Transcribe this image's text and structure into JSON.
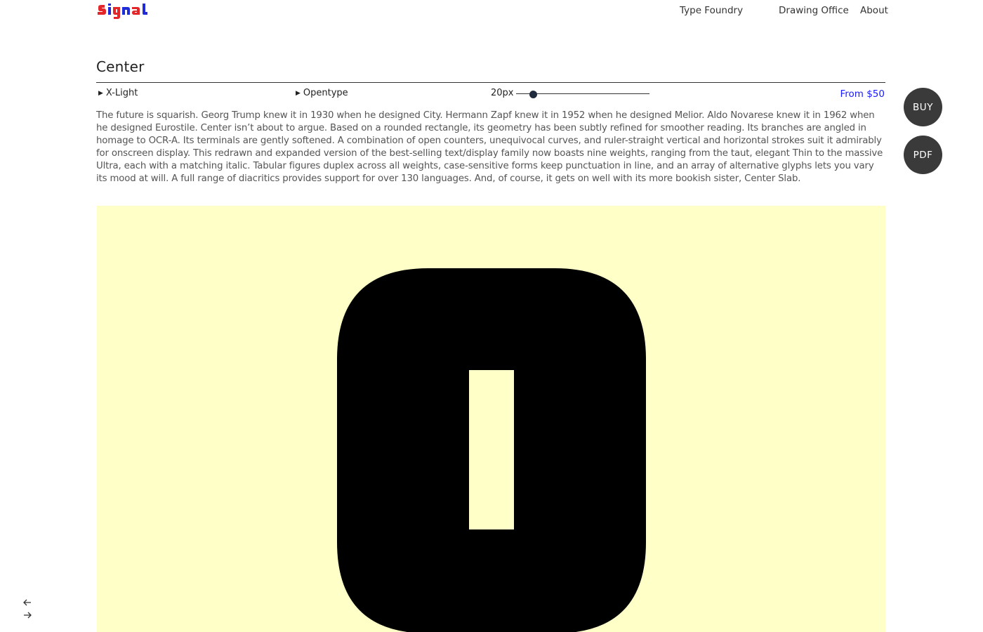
{
  "header": {
    "logo_text": "Signal",
    "nav": [
      {
        "label": "Type Foundry"
      },
      {
        "label": "Drawing Office"
      },
      {
        "label": "About"
      }
    ]
  },
  "font": {
    "name": "Center",
    "weight_selector": "X-Light",
    "features_selector": "Opentype",
    "size_label": "20px",
    "size_slider_fraction": 0.1,
    "price_label": "From $50",
    "description": "The future is squarish. Georg Trump knew it in 1930 when he designed City. Hermann Zapf knew it in 1952 when he designed Melior. Aldo Novarese knew it in 1962 when he designed Eurostile. Center isn’t about to argue. Based on a rounded rectangle, its geometry has been subtly refined for smoother reading. Its branches are angled in homage to OCR-A. Its terminals are gently softened. A combination of open counters, unequivocal curves, and ruler-straight vertical and horizontal strokes suit it admirably for onscreen display. This redrawn and expanded version of the best-selling text/display family now boasts nine weights, ranging from the taut, elegant Thin to the massive Ultra, each with a matching italic. Tabular figures duplex across all weights, case-sensitive forms keep punctuation in line, and an array of alternative glyphs lets you vary its mood at will. A full range of diacritics provides support for over 130 languages. And, of course, it gets on well with its more bookish sister, Center Slab."
  },
  "actions": {
    "buy_label": "BUY",
    "pdf_label": "PDF"
  },
  "specimen": {
    "glyph": "0",
    "background_color": "#ffffc8",
    "glyph_color": "#000000"
  },
  "pager": {
    "prev_icon": "arrow-left-icon",
    "next_icon": "arrow-right-icon"
  },
  "colors": {
    "logo_red": "#e3262a",
    "logo_blue": "#1f2bd6",
    "price_link": "#1a1aff",
    "button_bg": "#3a3a3a"
  }
}
